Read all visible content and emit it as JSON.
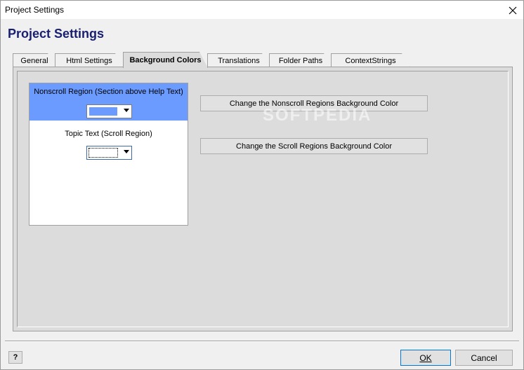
{
  "window": {
    "title": "Project Settings"
  },
  "dialog": {
    "heading": "Project Settings"
  },
  "tabs": [
    {
      "label": "General"
    },
    {
      "label": "Html Settings"
    },
    {
      "label": "Background Colors"
    },
    {
      "label": "Translations"
    },
    {
      "label": "Folder Paths"
    },
    {
      "label": "ContextStrings"
    }
  ],
  "active_tab": "Background Colors",
  "preview": {
    "nonscroll_label": "Nonscroll Region (Section above Help Text)",
    "nonscroll_color": "#6b9bff",
    "scroll_label": "Topic Text (Scroll Region)",
    "scroll_color": "#ffffff"
  },
  "buttons": {
    "change_nonscroll": "Change the Nonscroll Regions Background Color",
    "change_scroll": "Change the Scroll Regions Background Color",
    "ok": "OK",
    "cancel": "Cancel",
    "help": "?"
  },
  "watermark": "SOFTPEDIA"
}
